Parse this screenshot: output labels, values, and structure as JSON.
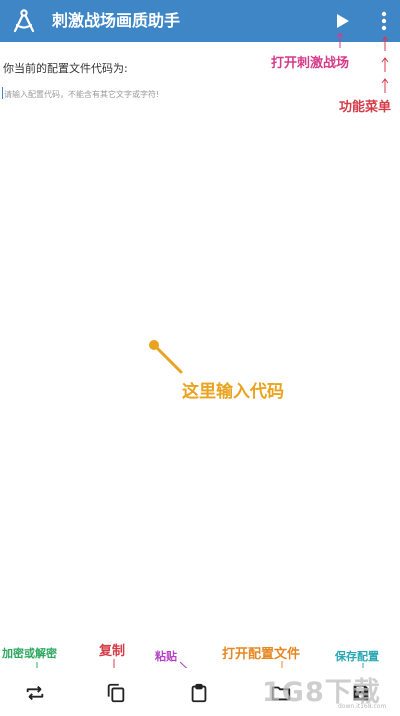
{
  "app_bar": {
    "title": "刺激战场画质助手",
    "icons": [
      "compass-app-icon",
      "play-icon",
      "more-vert-icon"
    ],
    "background_color": "#3f86c7"
  },
  "editor": {
    "prompt_label": "你当前的配置文件代码为:",
    "input_placeholder": "请输入配置代码，不能含有其它文字或字符!",
    "input_value": ""
  },
  "annotations": {
    "open_game": "打开刺激战场",
    "menu": "功能菜单",
    "enter_code": "这里输入代码",
    "encrypt_decrypt": "加密或解密",
    "copy": "复制",
    "paste": "粘贴",
    "open_config": "打开配置文件",
    "save_config": "保存配置"
  },
  "annotation_colors": {
    "open_game": "#d63b8a",
    "menu": "#d63b48",
    "enter_code": "#eaa31e",
    "encrypt_decrypt": "#2ea861",
    "copy": "#d63b48",
    "paste": "#b540c8",
    "open_config": "#e58824",
    "save_config": "#2aa8b6"
  },
  "toolbar": {
    "icons": [
      "swap-icon",
      "copy-icon",
      "clipboard-icon",
      "folder-icon",
      "save-icon"
    ]
  },
  "watermark": {
    "text": "1G8下载",
    "url": "down.it168.com"
  }
}
